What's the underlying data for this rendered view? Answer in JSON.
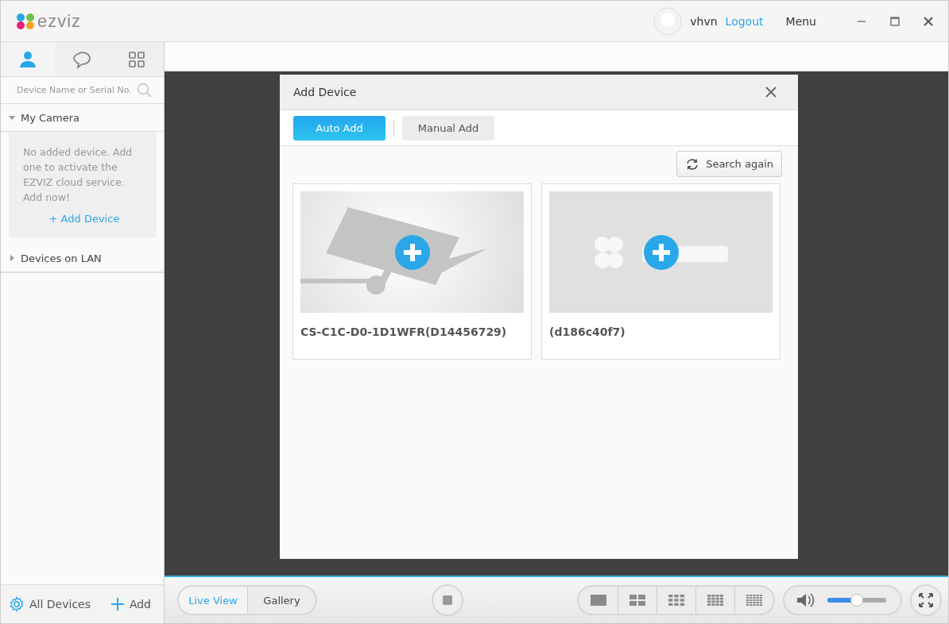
{
  "app": {
    "logo": "ezviz",
    "user": "vhvn",
    "logout": "Logout",
    "menu": "Menu"
  },
  "sidebar": {
    "tabs": [
      {
        "kind": "person",
        "selected": true
      },
      {
        "kind": "chat",
        "selected": false
      },
      {
        "kind": "grid",
        "selected": false
      }
    ],
    "search": {
      "placeholder": "Device Name or Serial No."
    },
    "groups": [
      {
        "label": "My Camera",
        "expanded": true,
        "message": "No added device. Add one to activate the EZVIZ cloud service. Add now!",
        "link": "+ Add Device"
      },
      {
        "label": "Devices on LAN",
        "expanded": false
      }
    ],
    "footer": {
      "all_devices": "All Devices",
      "add": "Add"
    }
  },
  "dialog": {
    "title": "Add Device",
    "tabs": [
      {
        "label": "Auto Add",
        "selected": true
      },
      {
        "label": "Manual Add",
        "selected": false
      }
    ],
    "search_again": "Search again",
    "devices": [
      {
        "name": "CS-C1C-D0-1D1WFR(D14456729)",
        "kind": "camera"
      },
      {
        "name": "(d186c40f7)",
        "kind": "logo"
      }
    ]
  },
  "bottom": {
    "view_tabs": [
      {
        "label": "Live View",
        "selected": true
      },
      {
        "label": "Gallery",
        "selected": false
      }
    ],
    "layouts": [
      {
        "kind": "n1"
      },
      {
        "kind": "n2"
      },
      {
        "kind": "n3"
      },
      {
        "kind": "n4"
      },
      {
        "kind": "n5"
      }
    ],
    "volume": {
      "level": 0.5
    }
  }
}
